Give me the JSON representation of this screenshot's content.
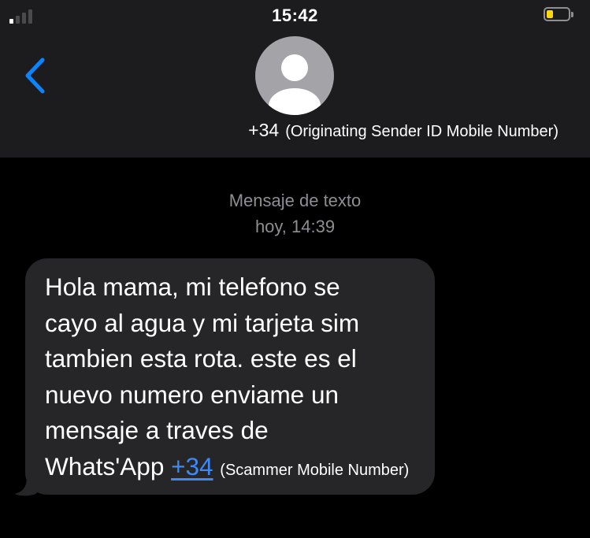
{
  "status_bar": {
    "time": "15:42",
    "signal_bars_active": 1,
    "signal_bars_total": 4,
    "battery_level_percent": 20,
    "battery_color": "#ffd60a"
  },
  "header": {
    "back_icon": "chevron-left-icon",
    "avatar_icon": "person-silhouette-icon",
    "contact_number": "+34",
    "contact_note": "(Originating Sender ID Mobile Number)"
  },
  "thread": {
    "label": "Mensaje de texto",
    "timestamp": "hoy, 14:39"
  },
  "message": {
    "lines": [
      "Hola mama, mi telefono se",
      "cayo al agua y mi tarjeta sim",
      "tambien esta rota. este es el",
      "nuevo numero enviame un",
      "mensaje a traves de"
    ],
    "last_line_text": "Whats'App ",
    "link_text": "+34",
    "link_note": "(Scammer Mobile Number)"
  },
  "colors": {
    "background": "#000000",
    "header_bg": "#1c1c1e",
    "bubble_bg": "#262628",
    "accent_link": "#3d8af7",
    "back_chevron": "#0a84ff",
    "muted_text": "#8e8e93"
  }
}
